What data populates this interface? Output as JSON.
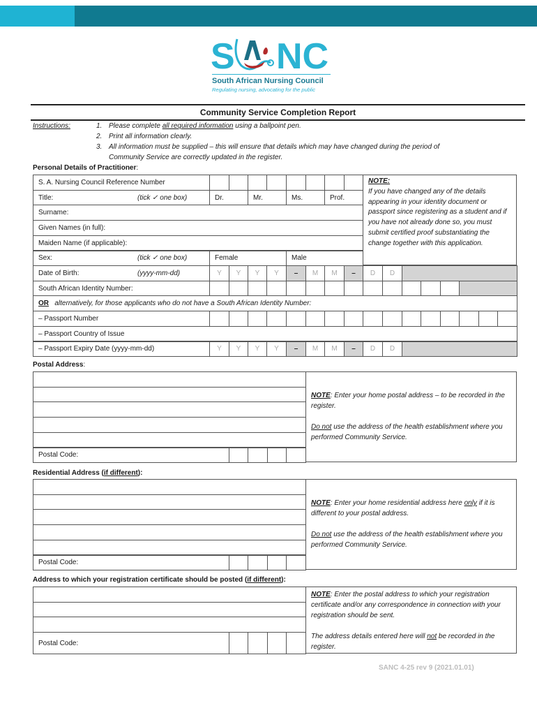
{
  "header": {
    "brand_colors": {
      "bar_dark": "#107a90",
      "bar_light": "#1fb3d3"
    },
    "logo": {
      "letters": "SANC",
      "org_name": "South African Nursing Council",
      "tagline": "Regulating nursing, advocating for the public"
    }
  },
  "document": {
    "title": "Community Service Completion Report",
    "instructions_label": "Instructions:",
    "instructions": [
      {
        "num": "1.",
        "pre": "Please complete ",
        "underlined": "all required information",
        "post": " using a ballpoint pen."
      },
      {
        "num": "2.",
        "pre": "Print all information clearly.",
        "underlined": "",
        "post": ""
      },
      {
        "num": "3.",
        "pre": "All information must be supplied – this will ensure that details which may have changed during the period of",
        "underlined": "",
        "post": ""
      },
      {
        "num": "",
        "pre": "Community Service are correctly updated in the register.",
        "underlined": "",
        "post": ""
      }
    ]
  },
  "personal": {
    "heading": "Personal Details of Practitioner",
    "ref_label": "S. A. Nursing Council Reference Number",
    "title_label": "Title:",
    "tick_hint": "(tick ✓ one box)",
    "title_options": [
      "Dr.",
      "Mr.",
      "Ms.",
      "Prof."
    ],
    "surname_label": "Surname:",
    "given_label": "Given Names (in full):",
    "maiden_label": "Maiden Name (if applicable):",
    "sex_label": "Sex:",
    "sex_options": [
      "Female",
      "Male"
    ],
    "dob_label": "Date of Birth:",
    "dob_hint": "(yyyy-mm-dd)",
    "date_placeholders": [
      "Y",
      "Y",
      "Y",
      "Y",
      "–",
      "M",
      "M",
      "–",
      "D",
      "D"
    ],
    "id_label": "South African Identity Number:",
    "or_word": "OR",
    "or_text": "alternatively, for those applicants who do not have a South African Identity Number:",
    "passport_number_label": "–   Passport Number",
    "passport_country_label": "–   Passport Country of Issue",
    "passport_expiry_label": "–   Passport Expiry Date (yyyy-mm-dd)",
    "note": {
      "heading": "NOTE:",
      "text": "If you have changed any of the details appearing in your identity document or passport since registering as a student and if you have not already done so, you must submit certified proof substantiating the change together with this application."
    }
  },
  "postal": {
    "heading": "Postal Address",
    "postal_code_label": "Postal Code:",
    "note_heading": "NOTE",
    "note_line1": ":  Enter your home postal address – to be recorded in the register.",
    "note_do_not": "Do not",
    "note_line2": " use the address of the health establishment where you performed Community Service."
  },
  "residential": {
    "heading": "Residential Address (",
    "heading_underlined": "if different",
    "heading_end": "):",
    "postal_code_label": "Postal Code:",
    "note_heading": "NOTE",
    "note_line1a": ":  Enter your home residential address here ",
    "note_only": "only",
    "note_line1b": " if it is different to your postal address.",
    "note_do_not": "Do not",
    "note_line2": " use the address of the health establishment where you performed Community Service."
  },
  "certificate": {
    "heading": "Address to which your registration certificate should be posted (",
    "heading_underlined": "if different",
    "heading_end": "):",
    "postal_code_label": "Postal Code:",
    "note_heading": "NOTE",
    "note_line1": ":  Enter the postal address to which your registration certificate and/or any correspondence in connection with your registration should be sent.",
    "note_line2a": "The address details entered here will ",
    "note_not": "not",
    "note_line2b": " be recorded in the register."
  },
  "footer": {
    "form_code": "SANC 4-25 rev 9 (2021.01.01)"
  }
}
